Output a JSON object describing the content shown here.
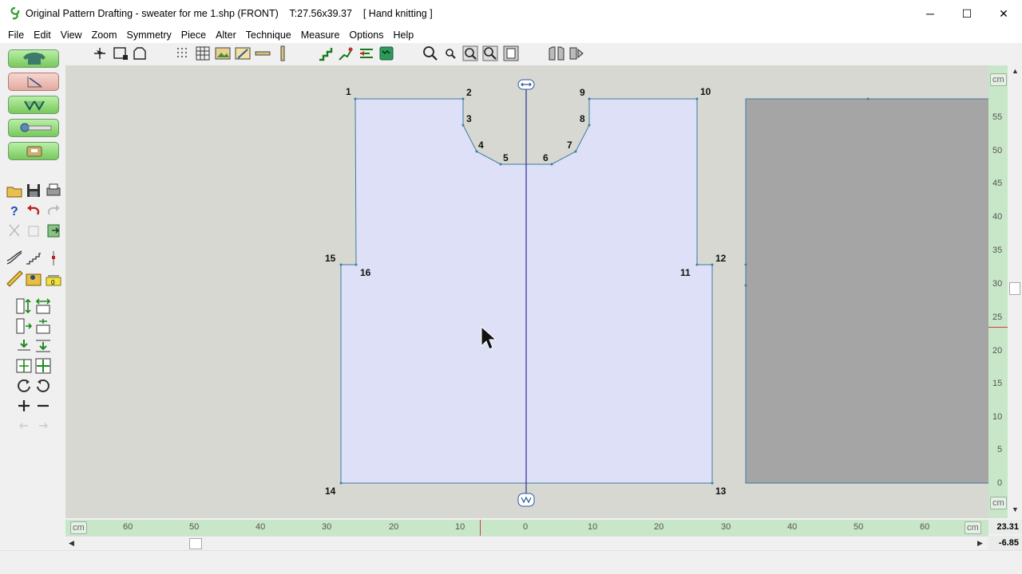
{
  "window": {
    "title": "Original Pattern Drafting - sweater for me 1.shp (FRONT)    T:27.56x39.37    [ Hand knitting ]",
    "minimize_glyph": "─",
    "maximize_glyph": "☐",
    "close_glyph": "✕"
  },
  "menu": [
    "File",
    "Edit",
    "View",
    "Zoom",
    "Symmetry",
    "Piece",
    "Alter",
    "Technique",
    "Measure",
    "Options",
    "Help"
  ],
  "points": [
    {
      "label": "1"
    },
    {
      "label": "2"
    },
    {
      "label": "3"
    },
    {
      "label": "4"
    },
    {
      "label": "5"
    },
    {
      "label": "6"
    },
    {
      "label": "7"
    },
    {
      "label": "8"
    },
    {
      "label": "9"
    },
    {
      "label": "10"
    },
    {
      "label": "11"
    },
    {
      "label": "12"
    },
    {
      "label": "13"
    },
    {
      "label": "14"
    },
    {
      "label": "15"
    },
    {
      "label": "16"
    }
  ],
  "colors": {
    "piece_fill": "#dde0f6",
    "piece_stroke": "#3d7d9e",
    "center_line": "#2b2b8f",
    "back_piece_fill": "#a5a5a5",
    "ruler_bg": "#c8e6c8"
  },
  "rulers": {
    "unit_label": "cm",
    "horizontal_ticks": [
      "60",
      "50",
      "40",
      "30",
      "20",
      "10",
      "0",
      "10",
      "20",
      "30",
      "40",
      "50",
      "60"
    ],
    "vertical_ticks": [
      "55",
      "50",
      "45",
      "40",
      "35",
      "30",
      "25",
      "20",
      "15",
      "10",
      "5",
      "0"
    ]
  },
  "cursor": {
    "x_readout": "23.31",
    "y_readout": "-6.85"
  }
}
